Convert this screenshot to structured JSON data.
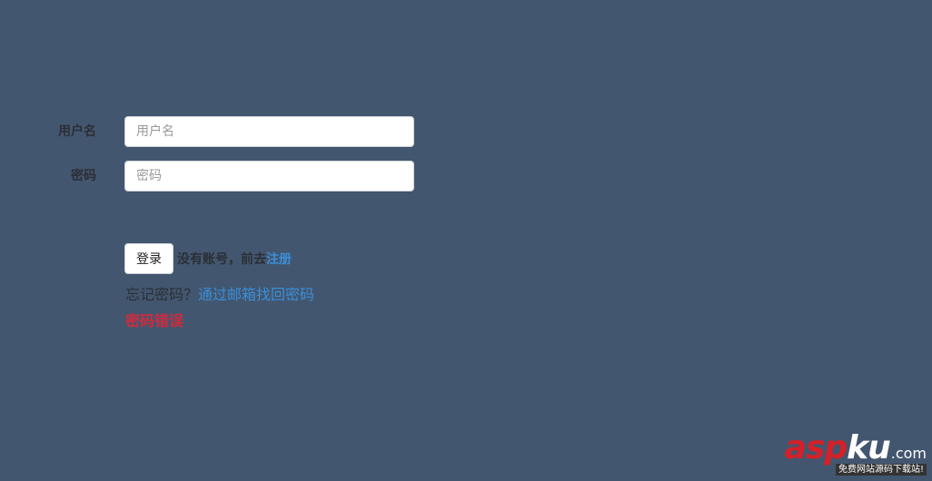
{
  "form": {
    "username": {
      "label": "用户名",
      "placeholder": "用户名",
      "value": ""
    },
    "password": {
      "label": "密码",
      "placeholder": "密码",
      "value": ""
    },
    "login_button": "登录",
    "no_account_text": "没有账号，前去",
    "register_link": "注册",
    "forgot_text": "忘记密码？",
    "recover_link": "通过邮箱找回密码",
    "error_message": "密码错误"
  },
  "watermark": {
    "brand_red": "asp",
    "brand_white": "ku",
    "domain": ".com",
    "tagline": "免费网站源码下载站!"
  },
  "colors": {
    "background": "#43566f",
    "link": "#3a8fd8",
    "error": "#d12a3c",
    "brand_red": "#d61f26"
  }
}
